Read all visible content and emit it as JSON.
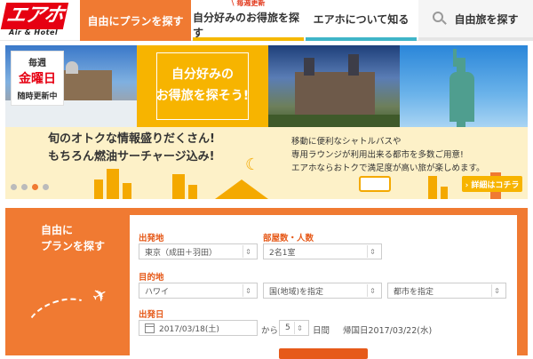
{
  "header": {
    "logo_main": "エアホ",
    "logo_sub": "Air & Hotel",
    "nav": [
      {
        "label": "自由にプランを探す"
      },
      {
        "badge": "毎週更新",
        "label": "自分好みのお得旅を探す"
      },
      {
        "label": "エアホについて知る"
      },
      {
        "label": "自由旅を探す"
      }
    ]
  },
  "banner": {
    "weekly_1": "毎週",
    "weekly_2": "金曜日",
    "weekly_3": "随時更新中",
    "center_line1": "自分好みの",
    "center_line2": "お得旅を探そう!",
    "copy_left_1": "旬のオトクな情報盛りだくさん!",
    "copy_left_2": "もちろん燃油サーチャージ込み!",
    "copy_right_1": "移動に便利なシャトルバスや",
    "copy_right_2": "専用ラウンジが利用出来る都市を多数ご用意!",
    "copy_right_3": "エアホならおトクで満足度が高い旅が楽しめます。",
    "detail_button": "› 詳細はコチラ",
    "slide_count": 4,
    "active_slide": 3
  },
  "search": {
    "title_1": "自由に",
    "title_2": "プランを探す",
    "departure_label": "出発地",
    "departure_value": "東京（成田＋羽田）",
    "rooms_label": "部屋数・人数",
    "rooms_value": "2名1室",
    "destination_label": "目的地",
    "destination_region": "ハワイ",
    "country_value": "国(地域)を指定",
    "city_value": "都市を指定",
    "date_label": "出発日",
    "date_value": "2017/03/18(土)",
    "from_text": "から",
    "days_value": "5",
    "days_unit": "日間",
    "return_text": "帰国日2017/03/22(水)"
  }
}
